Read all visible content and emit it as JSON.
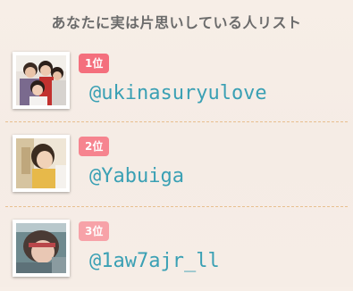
{
  "title": "あなたに実は片思いしている人リスト",
  "ranking": [
    {
      "rank": "1位",
      "handle": "@ukinasuryulove",
      "image": "avatar-photo"
    },
    {
      "rank": "2位",
      "handle": "@Yabuiga",
      "image": "avatar-photo"
    },
    {
      "rank": "3位",
      "handle": "@1aw7ajr_ll",
      "image": "avatar-photo"
    }
  ],
  "colors": {
    "handle": "#3aa0b4",
    "badge_1": "#f46f7d",
    "badge_2": "#f6848f",
    "badge_3": "#f7a2a8",
    "separator": "#e8bf8f"
  }
}
